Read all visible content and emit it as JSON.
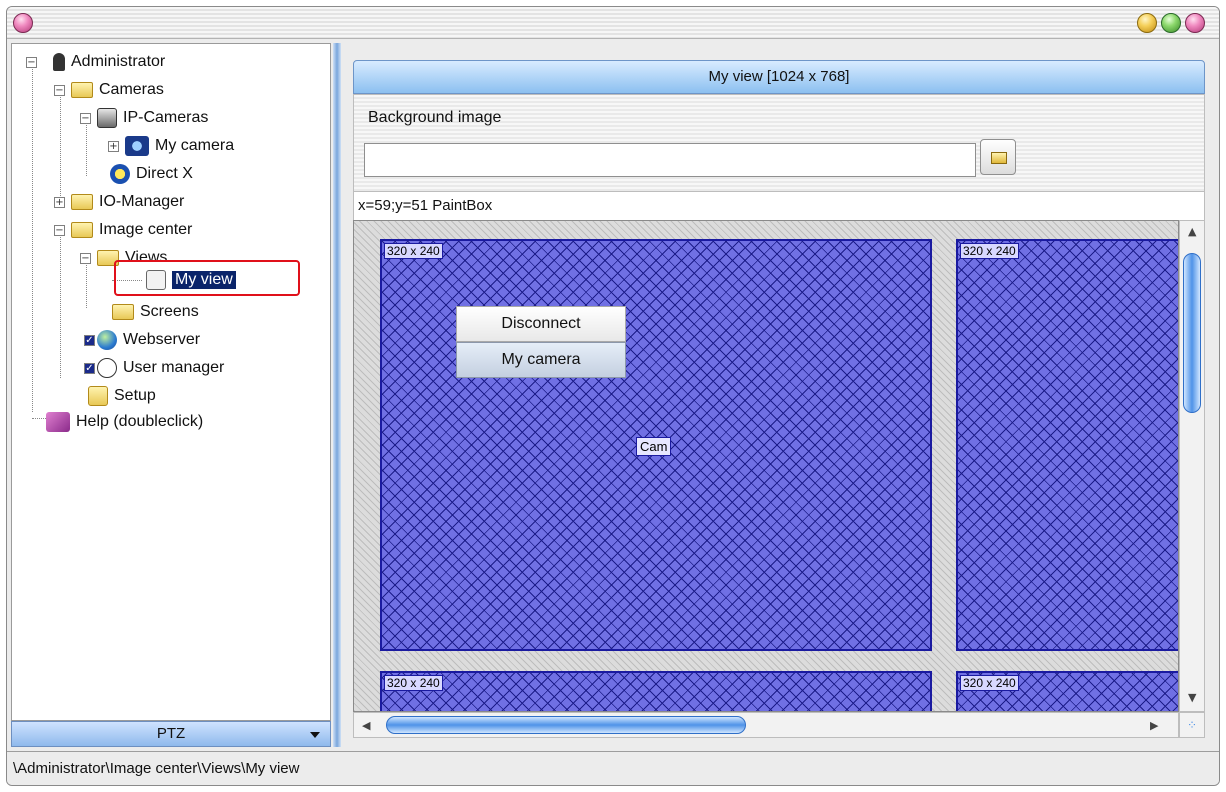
{
  "window": {
    "titlebar_buttons": [
      "pink-orb",
      "yellow-orb",
      "green-orb",
      "pink-orb"
    ]
  },
  "tree": {
    "items": [
      {
        "label": "Administrator",
        "icon": "user-icon"
      },
      {
        "label": "Cameras",
        "icon": "folder-icon"
      },
      {
        "label": "IP-Cameras",
        "icon": "ip-cameras-icon"
      },
      {
        "label": "My camera",
        "icon": "camera-icon"
      },
      {
        "label": "Direct X",
        "icon": "directx-icon"
      },
      {
        "label": "IO-Manager",
        "icon": "folder-icon"
      },
      {
        "label": "Image center",
        "icon": "folder-icon"
      },
      {
        "label": "Views",
        "icon": "folder-open-icon"
      },
      {
        "label": "My view",
        "icon": "view-icon",
        "selected": true
      },
      {
        "label": "Screens",
        "icon": "folder-icon"
      },
      {
        "label": "Webserver",
        "icon": "globe-icon",
        "checked": true
      },
      {
        "label": "User manager",
        "icon": "users-icon",
        "checked": true
      },
      {
        "label": "Setup",
        "icon": "setup-icon"
      },
      {
        "label": "Help (doubleclick)",
        "icon": "help-book-icon"
      }
    ]
  },
  "ptz": {
    "label": "PTZ"
  },
  "view_panel": {
    "title": "My view [1024 x 768]",
    "background_label": "Background image",
    "background_value": "",
    "coords": "x=59;y=51 PaintBox"
  },
  "cells": [
    {
      "label": "320 x 240"
    },
    {
      "label": "320 x 240"
    },
    {
      "label": "320 x 240"
    },
    {
      "label": "320 x 240"
    }
  ],
  "cam_label": "Cam",
  "context_menu": {
    "items": [
      "Disconnect",
      "My camera"
    ]
  },
  "status": {
    "path": "\\Administrator\\Image center\\Views\\My view"
  },
  "colors": {
    "accent": "#4f93e8",
    "selection": "#0a246a",
    "highlight_border": "#e0101a",
    "cell_fill": "#7070e4"
  }
}
